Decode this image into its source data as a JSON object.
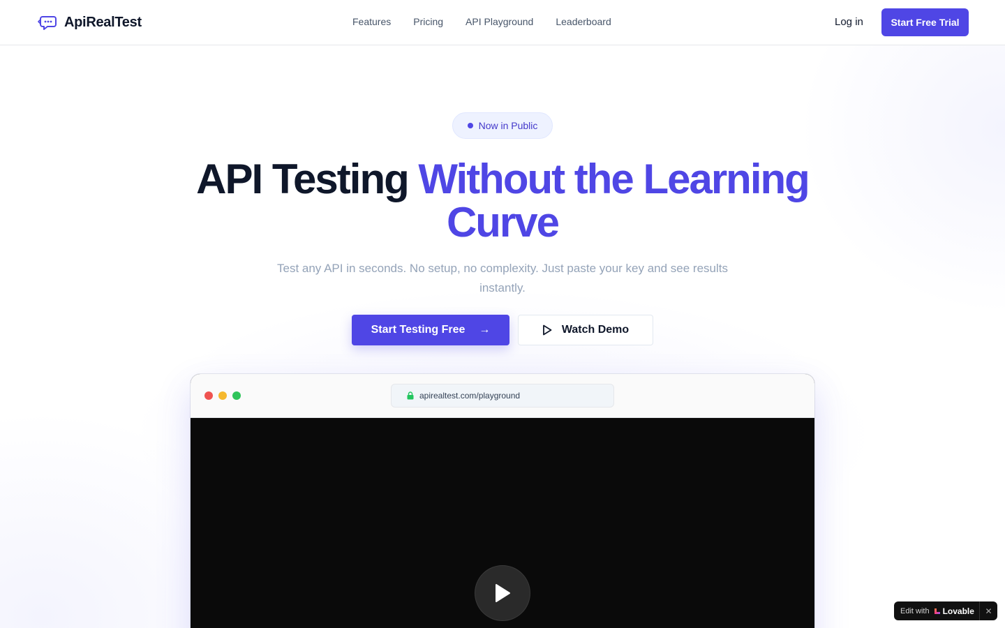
{
  "brand": {
    "name": "ApiRealTest",
    "icon": "chat-bubble-code-icon",
    "accent": "#4f46e5"
  },
  "nav": {
    "links": [
      "Features",
      "Pricing",
      "API Playground",
      "Leaderboard"
    ],
    "login_label": "Log in",
    "trial_label": "Start Free Trial"
  },
  "hero": {
    "badge": "Now in Public",
    "headline_main": "API Testing",
    "headline_accent": "Without the Learning Curve",
    "subtext": "Test any API in seconds. No setup, no complexity. Just paste your key and see results instantly.",
    "primary_cta": "Start Testing Free",
    "primary_cta_icon": "→",
    "secondary_cta": "Watch Demo"
  },
  "preview": {
    "url": "apirealtest.com/playground",
    "lock_icon": "lock-icon",
    "play_icon": "play-icon"
  },
  "lovable": {
    "prefix": "Edit with",
    "brand": "Lovable",
    "close": "✕"
  }
}
